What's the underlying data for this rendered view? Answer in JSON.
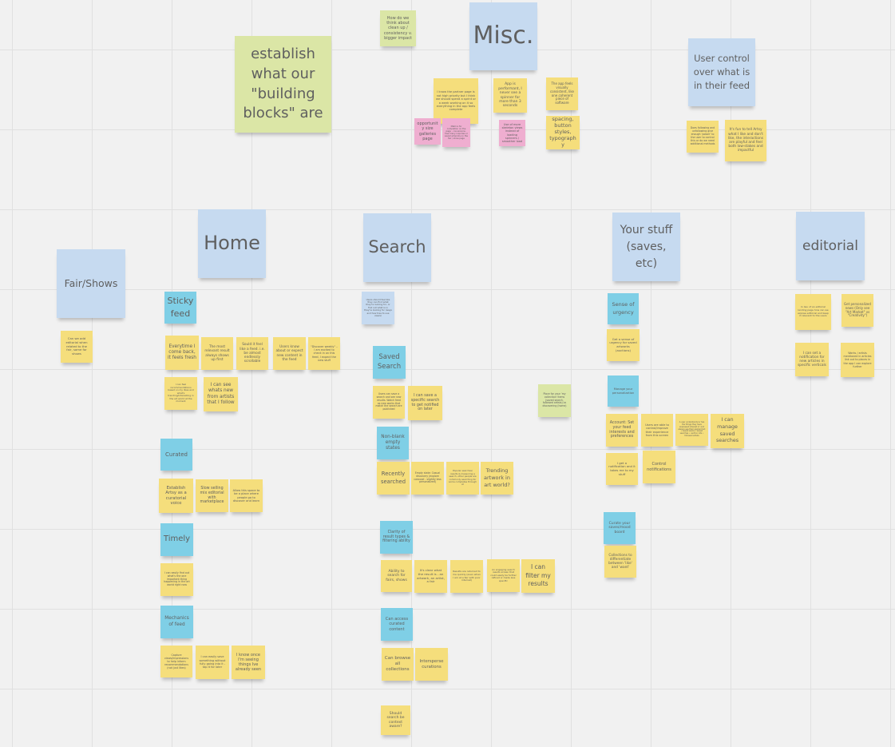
{
  "board": {
    "colors": {
      "background": "#f1f1f1",
      "grid": "#e0e0e0",
      "yellow": "#f5de7c",
      "blue": "#c6daf0",
      "cyan": "#7fcfe6",
      "green": "#dbe6a6",
      "pink": "#efaed0"
    },
    "notes": [
      {
        "id": "misc-cleanup",
        "color": "green",
        "text": "How do we think about clean up / consistency v. bigger impact"
      },
      {
        "id": "misc-header",
        "color": "blue",
        "text": "Misc."
      },
      {
        "id": "building-blocks",
        "color": "green",
        "text": "establish what our \"building blocks\" are"
      },
      {
        "id": "misc-partner-page",
        "color": "yellow",
        "text": "I know the partner page is not high priority but I think we should spend a sprint or a week working on it so everything in the app feels complete"
      },
      {
        "id": "misc-performant",
        "color": "yellow",
        "text": "App is performant, I never see a spinner for more than 3 seconds"
      },
      {
        "id": "misc-visually-consistent",
        "color": "yellow",
        "text": "The app feels visually consistent, like one coherent piece of software"
      },
      {
        "id": "misc-opportunity",
        "color": "pink",
        "text": "opportunity size galleries page"
      },
      {
        "id": "misc-pink-2",
        "color": "pink",
        "text": "Metrics for completion on the page · conversions · how many inquiries or saved artworks on the fair / show page"
      },
      {
        "id": "misc-spinners",
        "color": "pink",
        "text": "Use of more skeleton views instead of loading spinners / smoother load"
      },
      {
        "id": "misc-spacing",
        "color": "yellow",
        "text": "spacing, button styles, typography"
      },
      {
        "id": "user-control-header",
        "color": "blue",
        "text": "User control over what is in their feed"
      },
      {
        "id": "uc-following",
        "color": "yellow",
        "text": "Does following and unfollowing give enough 'power' to the user to control this or do we need additional methods"
      },
      {
        "id": "uc-fun",
        "color": "yellow",
        "text": "It's fun to tell Artsy what I like and don't like, the interactions are playful and feel both low-stakes and impactful"
      },
      {
        "id": "home-header",
        "color": "blue",
        "text": "Home"
      },
      {
        "id": "search-header",
        "color": "blue",
        "text": "Search"
      },
      {
        "id": "your-stuff-header",
        "color": "blue",
        "text": "Your stuff (saves, etc)"
      },
      {
        "id": "editorial-header",
        "color": "blue",
        "text": "editorial"
      },
      {
        "id": "fair-shows-header",
        "color": "blue",
        "text": "Fair/Shows"
      },
      {
        "id": "fair-editorial",
        "color": "yellow",
        "text": "Can we add editorial when related to the fair, same for shows"
      },
      {
        "id": "sticky-feed",
        "color": "cyan",
        "text": "Sticky feed"
      },
      {
        "id": "home-fresh",
        "color": "yellow",
        "text": "Everytime I come back, it feels fresh"
      },
      {
        "id": "home-relevant",
        "color": "yellow",
        "text": "The most relevant result always shows up first"
      },
      {
        "id": "home-feed",
        "color": "yellow",
        "text": "Sould it feel like a feed. i.e. be almost endlessly scrollable"
      },
      {
        "id": "home-expect",
        "color": "yellow",
        "text": "Users know about or expect new content in the feed"
      },
      {
        "id": "home-discover-weekly",
        "color": "yellow",
        "text": "\"Discover weekly\" – I am excited to check in on this feed, I expect the new stuff"
      },
      {
        "id": "home-recommend",
        "color": "yellow",
        "text": "I can feel recommendations based on my likes and what's trending/interesting in the art world at the moment"
      },
      {
        "id": "home-artists-follow",
        "color": "yellow",
        "text": "I can see whats new from artists that I follow"
      },
      {
        "id": "curated",
        "color": "cyan",
        "text": "Curated"
      },
      {
        "id": "curated-voice",
        "color": "yellow",
        "text": "Establish Artsy as a curatorial voice"
      },
      {
        "id": "curated-slow-selling",
        "color": "yellow",
        "text": "Slow selling mix editorial with marketplace"
      },
      {
        "id": "curated-discover",
        "color": "yellow",
        "text": "Allow this space to be a place where people go to discover and learn"
      },
      {
        "id": "timely",
        "color": "cyan",
        "text": "Timely"
      },
      {
        "id": "timely-important",
        "color": "yellow",
        "text": "I can easily find out what's the one important thing happening in the art world right now"
      },
      {
        "id": "mechanics-of-feed",
        "color": "cyan",
        "text": "Mechanics of feed"
      },
      {
        "id": "mech-capture-views",
        "color": "yellow",
        "text": "Capture views/impressions to help inform recommendations (not just likes)"
      },
      {
        "id": "mech-save",
        "color": "yellow",
        "text": "I can easily save something without fully going into it - tap it for later"
      },
      {
        "id": "mech-seen",
        "color": "yellow",
        "text": "I know once I'm seeing things Ive already seen"
      },
      {
        "id": "search-blue-note",
        "color": "blue",
        "text": "Users should feel like they can find what they're looking for, or find out what is in they're looking for (ways and how tree to use views)"
      },
      {
        "id": "saved-search",
        "color": "cyan",
        "text": "Saved Search"
      },
      {
        "id": "ss-save-search",
        "color": "yellow",
        "text": "Users can save a search and see new results. Watch feed as new works that match the search are published"
      },
      {
        "id": "ss-notified",
        "color": "yellow",
        "text": "I can save a specific search to get notified on later"
      },
      {
        "id": "non-blank-empty",
        "color": "cyan",
        "text": "Non-blank empty states"
      },
      {
        "id": "recently-searched",
        "color": "yellow",
        "text": "Recently searched"
      },
      {
        "id": "empty-state-casual",
        "color": "yellow",
        "text": "Empty state: Casual discovery (explore carousel - slightly less personalized)"
      },
      {
        "id": "popular-searches",
        "color": "yellow",
        "text": "Popular searches/ results & measuring a search, other people are commonly searching for some completes through AI"
      },
      {
        "id": "trending-artwork",
        "color": "yellow",
        "text": "Trending artwork in art world?"
      },
      {
        "id": "clarity-results",
        "color": "cyan",
        "text": "Clarity of result types & filtering ability"
      },
      {
        "id": "search-fairs-shows",
        "color": "yellow",
        "text": "Ability to search for fairs, shows"
      },
      {
        "id": "clear-result-type",
        "color": "yellow",
        "text": "It's clear what the result is - an artwork, an artist, a fair"
      },
      {
        "id": "results-quickly",
        "color": "yellow",
        "text": "Results are returned to me quickly (even when I am at a fair with poor internet)"
      },
      {
        "id": "engaging-results",
        "color": "yellow",
        "text": "An engaging search results screen that could easily be further refined or made less specific"
      },
      {
        "id": "filter-results",
        "color": "yellow",
        "text": "I can filter my results"
      },
      {
        "id": "access-curated",
        "color": "cyan",
        "text": "Can access curated content"
      },
      {
        "id": "browse-collections",
        "color": "yellow",
        "text": "Can browse all collections"
      },
      {
        "id": "intersperse-curations",
        "color": "yellow",
        "text": "Intersperse curations"
      },
      {
        "id": "search-context-aware",
        "color": "yellow",
        "text": "Should search be context aware?"
      },
      {
        "id": "place-for-your-things",
        "color": "green",
        "text": "Place for your 'my collection' items (saved search, followed artists) vs discovering (home)"
      },
      {
        "id": "sense-of-urgency",
        "color": "cyan",
        "text": "Sense of urgency"
      },
      {
        "id": "urgency-saved",
        "color": "yellow",
        "text": "Get a sense of urgency for saved artworks (auctions)"
      },
      {
        "id": "manage-personalization",
        "color": "cyan",
        "text": "Manage your personalization"
      },
      {
        "id": "account-preferences",
        "color": "yellow",
        "text": "Account: Set your feed interests and preferences"
      },
      {
        "id": "control-improve",
        "color": "yellow",
        "text": "Users are able to control/improve their experience from this screen"
      },
      {
        "id": "user-understands",
        "color": "yellow",
        "text": "A user understands & 'has the things they have expressed interest in' and always see their applied list: • saved works • saved searches • auction lots • followed artists"
      },
      {
        "id": "manage-saved-searches",
        "color": "yellow",
        "text": "I can manage saved searches"
      },
      {
        "id": "notification-stuff",
        "color": "yellow",
        "text": "I get a notification and it takes me to my stuff"
      },
      {
        "id": "control-notifications",
        "color": "yellow",
        "text": "Control notifications"
      },
      {
        "id": "curate-moodboard",
        "color": "cyan",
        "text": "Curate your saves/mood board"
      },
      {
        "id": "collections-like-want",
        "color": "yellow",
        "text": "Collections to differentiate between 'like' and 'want'"
      },
      {
        "id": "ed-landing-page",
        "color": "yellow",
        "text": "In lieu of an editorial landing page how can we expose editorial and keep it relevant to the users"
      },
      {
        "id": "ed-personalized-news",
        "color": "yellow",
        "text": "Get personalized news (Only see \"Art Market\" vs \"Creativity\")"
      },
      {
        "id": "ed-notification-verticals",
        "color": "yellow",
        "text": "I can set a notification for new articles in specific verticals"
      },
      {
        "id": "ed-works-mentioned",
        "color": "yellow",
        "text": "Works / artists mentioned in articles link out to places in the app I can explore further"
      }
    ]
  }
}
